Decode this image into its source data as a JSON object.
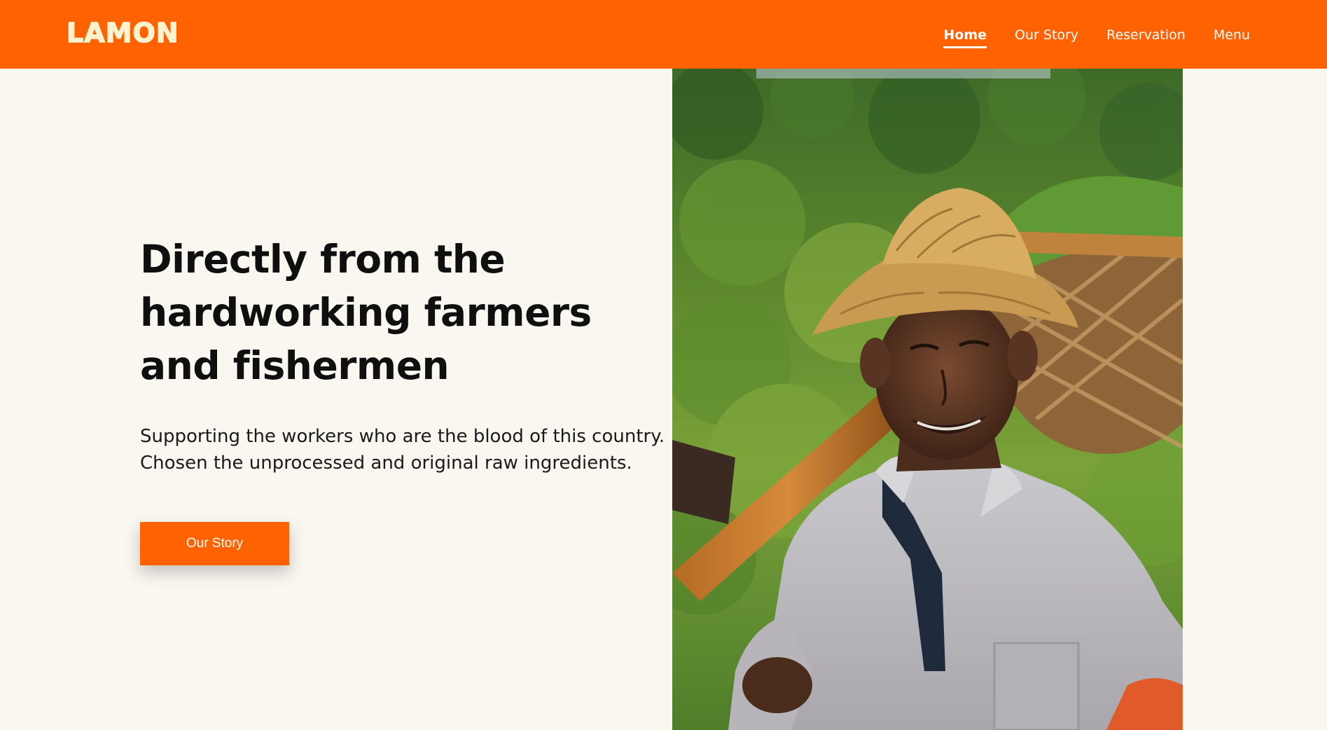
{
  "header": {
    "logo": "LAMON",
    "nav": [
      {
        "label": "Home",
        "active": true
      },
      {
        "label": "Our Story",
        "active": false
      },
      {
        "label": "Reservation",
        "active": false
      },
      {
        "label": "Menu",
        "active": false
      }
    ]
  },
  "hero": {
    "title": "Directly from the hardworking farmers and fishermen",
    "subtitle_line1": "Supporting the workers who are the blood of this country.",
    "subtitle_line2": "Chosen the unprocessed and original raw ingredients.",
    "cta_label": "Our Story",
    "image": "photo of a smiling elderly farmer in a woven straw hat carrying a bamboo pole with baskets in front of green rice terraces"
  },
  "colors": {
    "brand": "#ff6201",
    "background": "#faf7f0",
    "logo": "#fff3cf",
    "text": "#0f0f0f"
  }
}
